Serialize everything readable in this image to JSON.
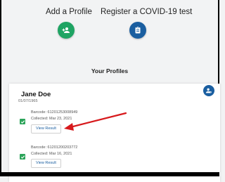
{
  "actions": {
    "add_profile_label": "Add a Profile",
    "register_test_label": "Register a COVID-19 test",
    "add_profile_color": "#1fa463",
    "register_test_color": "#1a5ea0",
    "add_profile_icon": "add-person-icon",
    "register_test_icon": "clipboard-icon"
  },
  "profiles_section": {
    "title": "Your Profiles"
  },
  "profile": {
    "name": "Jane Doe",
    "dob": "01/07/1965",
    "settings_icon": "person-settings-icon",
    "tests": [
      {
        "barcode": "Barcode: 61201253008949",
        "collected": "Collected: Mar 23, 2021",
        "button_label": "View Result"
      },
      {
        "barcode": "Barcode: 61201200203772",
        "collected": "Collected: Mar 16, 2021",
        "button_label": "View Result"
      }
    ]
  },
  "annotation": {
    "arrow_color": "#d7191c"
  }
}
